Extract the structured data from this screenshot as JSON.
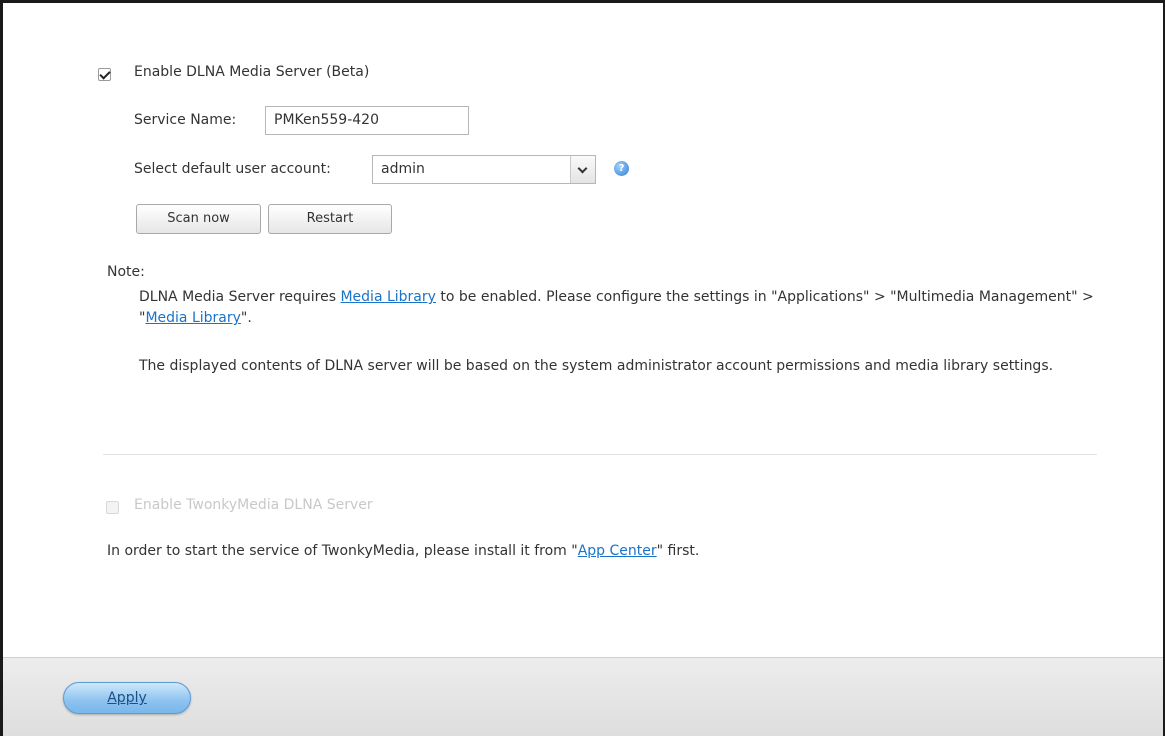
{
  "dlna": {
    "enable_label": "Enable DLNA Media Server (Beta)",
    "enabled": true,
    "service_name_label": "Service Name:",
    "service_name_value": "PMKen559-420",
    "default_user_label": "Select default user account:",
    "default_user_value": "admin",
    "scan_now_label": "Scan now",
    "restart_label": "Restart"
  },
  "note": {
    "title": "Note:",
    "line1_prefix": "DLNA Media Server requires ",
    "line1_link": "Media Library",
    "line1_middle": " to be enabled. Please configure the settings in \"Applications\" > \"Multimedia Management\" > \"",
    "line1_link2": "Media Library",
    "line1_suffix": "\".",
    "line2": "The displayed contents of DLNA server will be based on the system administrator account permissions and media library settings."
  },
  "twonky": {
    "enable_label": "Enable TwonkyMedia DLNA Server",
    "enabled": false,
    "install_prefix": "In order to start the service of TwonkyMedia, please install it from \"",
    "install_link": "App Center",
    "install_suffix": "\" first."
  },
  "footer": {
    "apply_label": "Apply"
  },
  "icons": {
    "help": "help-icon",
    "dropdown": "chevron-down-icon"
  }
}
